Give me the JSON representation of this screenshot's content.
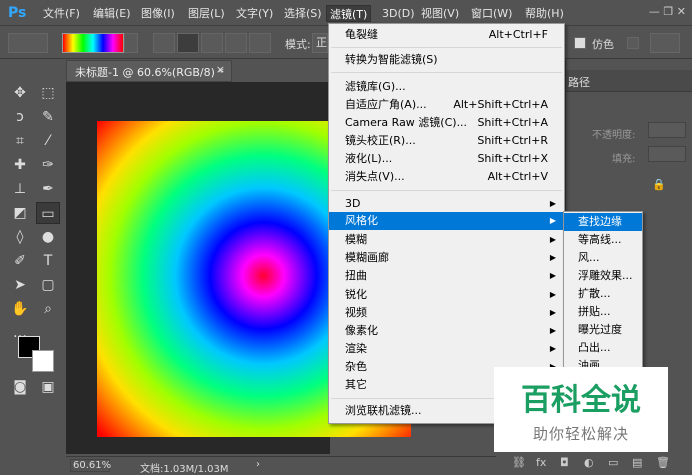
{
  "menubar": {
    "logo": "Ps",
    "items": [
      "文件(F)",
      "编辑(E)",
      "图像(I)",
      "图层(L)",
      "文字(Y)",
      "选择(S)",
      "滤镜(T)",
      "3D(D)",
      "视图(V)",
      "窗口(W)",
      "帮助(H)"
    ],
    "window_controls": "—  ❐  ✕"
  },
  "options": {
    "mode_label": "模式:",
    "mode_value": "正",
    "simulate_label": "仿色"
  },
  "document": {
    "tab_title": "未标题-1 @ 60.6%(RGB/8) *",
    "close": "×"
  },
  "status": {
    "zoom": "60.61%",
    "doc_size": "文档:1.03M/1.03M"
  },
  "filter_menu": {
    "items": [
      {
        "label": "龟裂缝",
        "shortcut": "Alt+Ctrl+F"
      },
      {
        "label": "转换为智能滤镜(S)",
        "shortcut": ""
      },
      {
        "label": "滤镜库(G)...",
        "shortcut": ""
      },
      {
        "label": "自适应广角(A)...",
        "shortcut": "Alt+Shift+Ctrl+A"
      },
      {
        "label": "Camera Raw 滤镜(C)...",
        "shortcut": "Shift+Ctrl+A"
      },
      {
        "label": "镜头校正(R)...",
        "shortcut": "Shift+Ctrl+R"
      },
      {
        "label": "液化(L)...",
        "shortcut": "Shift+Ctrl+X"
      },
      {
        "label": "消失点(V)...",
        "shortcut": "Alt+Ctrl+V"
      },
      {
        "label": "3D"
      },
      {
        "label": "风格化"
      },
      {
        "label": "模糊"
      },
      {
        "label": "模糊画廊"
      },
      {
        "label": "扭曲"
      },
      {
        "label": "锐化"
      },
      {
        "label": "视频"
      },
      {
        "label": "像素化"
      },
      {
        "label": "渲染"
      },
      {
        "label": "杂色"
      },
      {
        "label": "其它"
      },
      {
        "label": "浏览联机滤镜..."
      }
    ]
  },
  "stylize_submenu": {
    "items": [
      "查找边缘",
      "等高线...",
      "风...",
      "浮雕效果...",
      "扩散...",
      "拼贴...",
      "曝光过度",
      "凸出...",
      "油画..."
    ]
  },
  "right_panel": {
    "tab": "路径",
    "opacity_label": "不透明度:",
    "fill_label": "填充:"
  },
  "watermark": {
    "title": "百科全说",
    "subtitle": "助你轻松解决"
  }
}
